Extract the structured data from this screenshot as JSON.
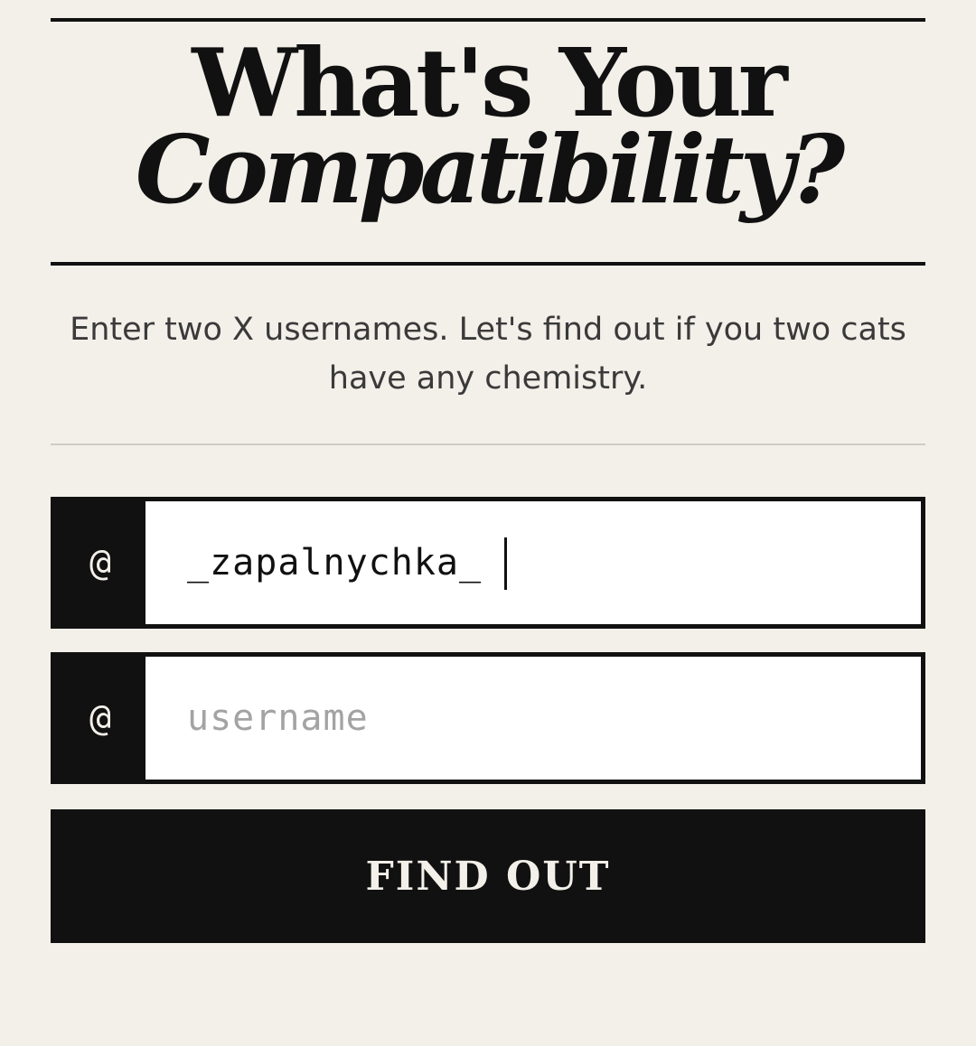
{
  "header": {
    "title_line1": "What's Your",
    "title_line2": "Compatibility?"
  },
  "intro": {
    "text": "Enter two X usernames. Let's find out if you two cats have any chemistry."
  },
  "form": {
    "prefix_symbol": "@",
    "username_1": {
      "value": "_zapalnychka_",
      "placeholder": "username"
    },
    "username_2": {
      "value": "",
      "placeholder": "username"
    },
    "submit_label": "FIND OUT"
  },
  "colors": {
    "background": "#f3efe9",
    "ink": "#111111",
    "placeholder": "#a3a3a3"
  }
}
